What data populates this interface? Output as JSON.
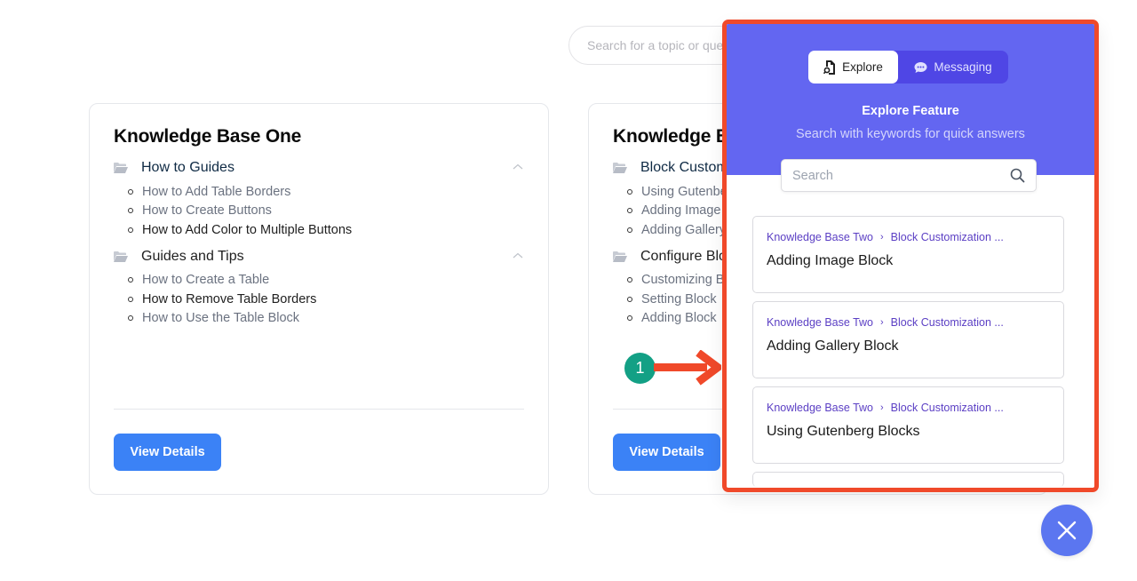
{
  "page": {
    "search": {
      "placeholder": "Search for a topic or question"
    }
  },
  "knowledge_bases": [
    {
      "title": "Knowledge Base One",
      "sections": [
        {
          "title": "How to Guides",
          "icon": "folder-open-icon",
          "expanded": true,
          "articles": [
            "How to Add Table Borders",
            "How to Create Buttons",
            "How to Add Color to Multiple Buttons"
          ]
        },
        {
          "title": "Guides and Tips",
          "icon": "folder-open-icon",
          "expanded": true,
          "articles": [
            "How to Create a Table",
            "How to Remove Table Borders",
            "How to Use the Table Block"
          ]
        }
      ],
      "button_label": "View Details"
    },
    {
      "title": "Knowledge Base Two",
      "sections": [
        {
          "title": "Block Customization",
          "icon": "folder-open-icon",
          "expanded": true,
          "articles": [
            "Using Gutenberg Blocks",
            "Adding Image Block",
            "Adding Gallery Block"
          ]
        },
        {
          "title": "Configure Blocks",
          "icon": "folder-open-icon",
          "expanded": true,
          "articles": [
            "Customizing Blocks",
            "Setting Block",
            "Adding Block"
          ]
        }
      ],
      "button_label": "View Details"
    }
  ],
  "annotation": {
    "step_number": "1",
    "badge_color": "#13a085",
    "arrow_color": "#f0492a"
  },
  "widget": {
    "highlight_color": "#f0492a",
    "header_color": "#6366f1",
    "tabs": [
      {
        "label": "Explore",
        "icon": "explore-doc-icon",
        "active": true
      },
      {
        "label": "Messaging",
        "icon": "chat-bubble-icon",
        "active": false
      }
    ],
    "title": "Explore Feature",
    "subtitle": "Search with keywords for quick answers",
    "search": {
      "placeholder": "Search",
      "value": ""
    },
    "results": [
      {
        "breadcrumb": [
          "Knowledge Base Two",
          "Block Customization ..."
        ],
        "title": "Adding Image Block"
      },
      {
        "breadcrumb": [
          "Knowledge Base Two",
          "Block Customization ..."
        ],
        "title": "Adding Gallery Block"
      },
      {
        "breadcrumb": [
          "Knowledge Base Two",
          "Block Customization ..."
        ],
        "title": "Using Gutenberg Blocks"
      }
    ],
    "close_button": {
      "icon": "close-icon",
      "color": "#5b76f0"
    }
  }
}
